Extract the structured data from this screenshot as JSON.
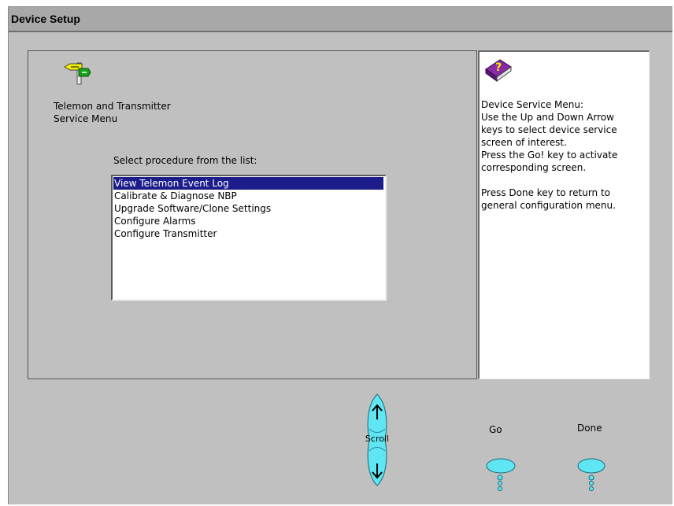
{
  "window": {
    "title": "Device Setup"
  },
  "device": {
    "title_line1": "Telemon and Transmitter",
    "title_line2": "Service Menu"
  },
  "procedure": {
    "label": "Select procedure from the list:",
    "items": [
      "View Telemon Event Log",
      "Calibrate & Diagnose NBP",
      "Upgrade Software/Clone Settings",
      "Configure Alarms",
      "Configure Transmitter"
    ],
    "selected_index": 0
  },
  "help": {
    "lines": [
      "Device Service Menu:",
      "Use the Up and Down Arrow",
      "keys to select device service",
      "screen of interest.",
      "Press the Go! key to activate",
      "corresponding screen.",
      "",
      "Press Done key to return to",
      "general configuration menu."
    ]
  },
  "controls": {
    "scroll_label": "Scroll",
    "go_label": "Go",
    "done_label": "Done"
  },
  "icons": {
    "device": "signpost-icon",
    "help": "help-book-icon",
    "up": "arrow-up-icon",
    "down": "arrow-down-icon"
  },
  "colors": {
    "background": "#c0c0c0",
    "selection": "#1c1c8a",
    "key_fill": "#5fe6f2"
  }
}
